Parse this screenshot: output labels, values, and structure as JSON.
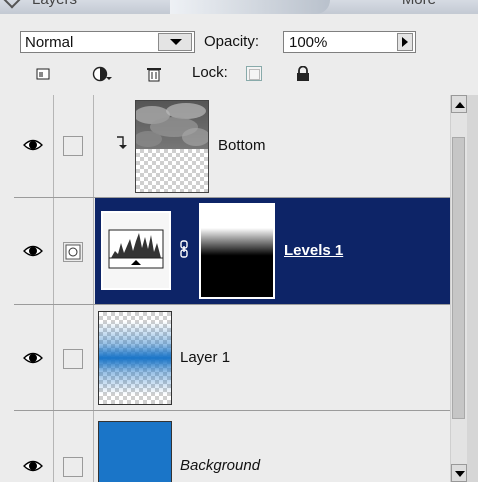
{
  "panel": {
    "title": "Layers",
    "more": "More"
  },
  "blend": {
    "mode": "Normal"
  },
  "opacity": {
    "label": "Opacity:",
    "value": "100%"
  },
  "lock": {
    "label": "Lock:"
  },
  "layers": [
    {
      "name": "Bottom",
      "type": "clipped-cloud"
    },
    {
      "name": "Levels 1",
      "type": "adjustment",
      "selected": true
    },
    {
      "name": "Layer 1",
      "type": "gradient"
    },
    {
      "name": "Background",
      "type": "fill",
      "locked": true
    }
  ],
  "colors": {
    "selection": "#0d2467",
    "blue": "#1a75c8",
    "panel": "#ececec"
  }
}
